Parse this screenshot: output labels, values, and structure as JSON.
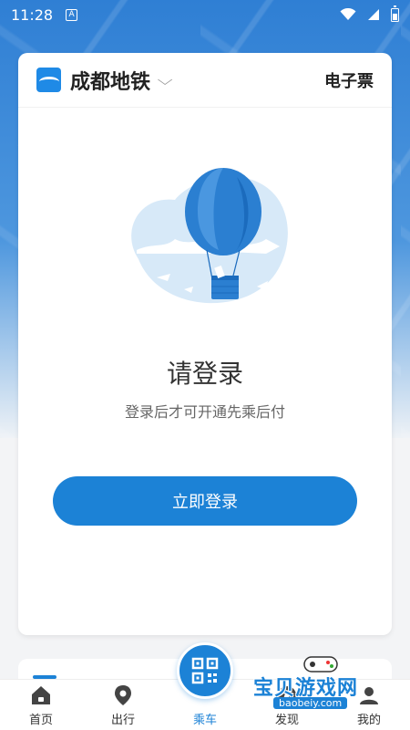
{
  "status_bar": {
    "time": "11:28",
    "notification_badge": "A"
  },
  "header": {
    "city": "成都地铁",
    "eticket_label": "电子票"
  },
  "login": {
    "title": "请登录",
    "subtitle": "登录后才可开通先乘后付",
    "button_label": "立即登录"
  },
  "tabbar": {
    "items": [
      {
        "label": "首页",
        "icon": "home-icon"
      },
      {
        "label": "出行",
        "icon": "location-pin-icon"
      },
      {
        "label": "乘车",
        "icon": "qr-code-icon",
        "active": true
      },
      {
        "label": "发现",
        "icon": "compass-icon"
      },
      {
        "label": "我的",
        "icon": "user-icon"
      }
    ]
  },
  "watermark": {
    "text": "宝贝游戏网",
    "url": "baobeiy.com"
  },
  "colors": {
    "brand_blue": "#1c82d6",
    "header_blue": "#2f7fd4"
  }
}
